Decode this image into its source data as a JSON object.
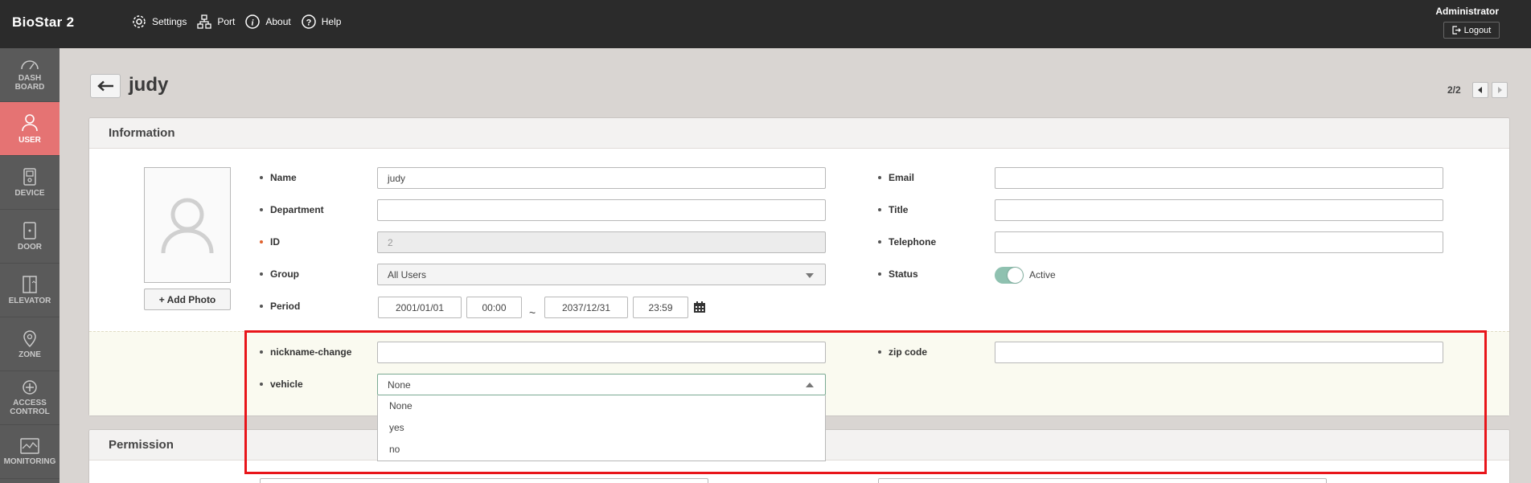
{
  "app": {
    "title": "BioStar 2"
  },
  "topnav": [
    {
      "label": "Settings",
      "icon": "gear-icon"
    },
    {
      "label": "Port",
      "icon": "network-icon"
    },
    {
      "label": "About",
      "icon": "info-icon"
    },
    {
      "label": "Help",
      "icon": "help-icon"
    }
  ],
  "account": {
    "name": "Administrator",
    "logout": "Logout"
  },
  "sidebar": [
    {
      "label_line1": "DASH",
      "label_line2": "BOARD",
      "icon": "dashboard-icon"
    },
    {
      "label_line1": "USER",
      "label_line2": "",
      "icon": "user-icon",
      "active": true
    },
    {
      "label_line1": "DEVICE",
      "label_line2": "",
      "icon": "device-icon"
    },
    {
      "label_line1": "DOOR",
      "label_line2": "",
      "icon": "door-icon"
    },
    {
      "label_line1": "ELEVATOR",
      "label_line2": "",
      "icon": "elevator-icon"
    },
    {
      "label_line1": "ZONE",
      "label_line2": "",
      "icon": "zone-icon"
    },
    {
      "label_line1": "ACCESS",
      "label_line2": "CONTROL",
      "icon": "access-control-icon"
    },
    {
      "label_line1": "MONITORING",
      "label_line2": "",
      "icon": "monitoring-icon"
    }
  ],
  "header": {
    "title": "judy",
    "pager": "2/2"
  },
  "information": {
    "section_title": "Information",
    "add_photo": "+ Add Photo",
    "fields": {
      "name": {
        "label": "Name",
        "value": "judy"
      },
      "department": {
        "label": "Department",
        "value": ""
      },
      "id": {
        "label": "ID",
        "value": "2"
      },
      "group": {
        "label": "Group",
        "value": "All Users"
      },
      "period": {
        "label": "Period",
        "start_date": "2001/01/01",
        "start_time": "00:00",
        "separator": "~",
        "end_date": "2037/12/31",
        "end_time": "23:59"
      },
      "email": {
        "label": "Email",
        "value": ""
      },
      "title": {
        "label": "Title",
        "value": ""
      },
      "telephone": {
        "label": "Telephone",
        "value": ""
      },
      "status": {
        "label": "Status",
        "value": "Active",
        "enabled": true
      }
    },
    "custom_fields": {
      "nickname": {
        "label": "nickname-change",
        "value": ""
      },
      "zip": {
        "label": "zip code",
        "value": ""
      },
      "vehicle": {
        "label": "vehicle",
        "value": "None",
        "options": [
          "None",
          "yes",
          "no"
        ]
      }
    }
  },
  "permission": {
    "section_title": "Permission"
  },
  "colors": {
    "accent": "#e57373",
    "highlight": "#e8151a",
    "topbar": "#2b2b2b",
    "sidebar": "#5a5a5a",
    "toggle_on": "#8fc1b0"
  }
}
